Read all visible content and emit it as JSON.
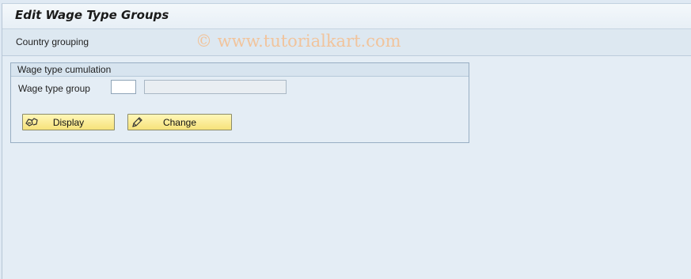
{
  "window": {
    "title": "Edit Wage Type Groups"
  },
  "toolbar": {
    "country_grouping": "Country grouping"
  },
  "watermark": "© www.tutorialkart.com",
  "group": {
    "title": "Wage type cumulation",
    "field_label": "Wage type group",
    "field_value": "",
    "field_description": ""
  },
  "buttons": {
    "display": {
      "label": "Display",
      "icon": "glasses-icon"
    },
    "change": {
      "label": "Change",
      "icon": "pencil-icon"
    }
  },
  "colors": {
    "button_bg": "#f8e58a",
    "watermark": "#f1c49c"
  }
}
